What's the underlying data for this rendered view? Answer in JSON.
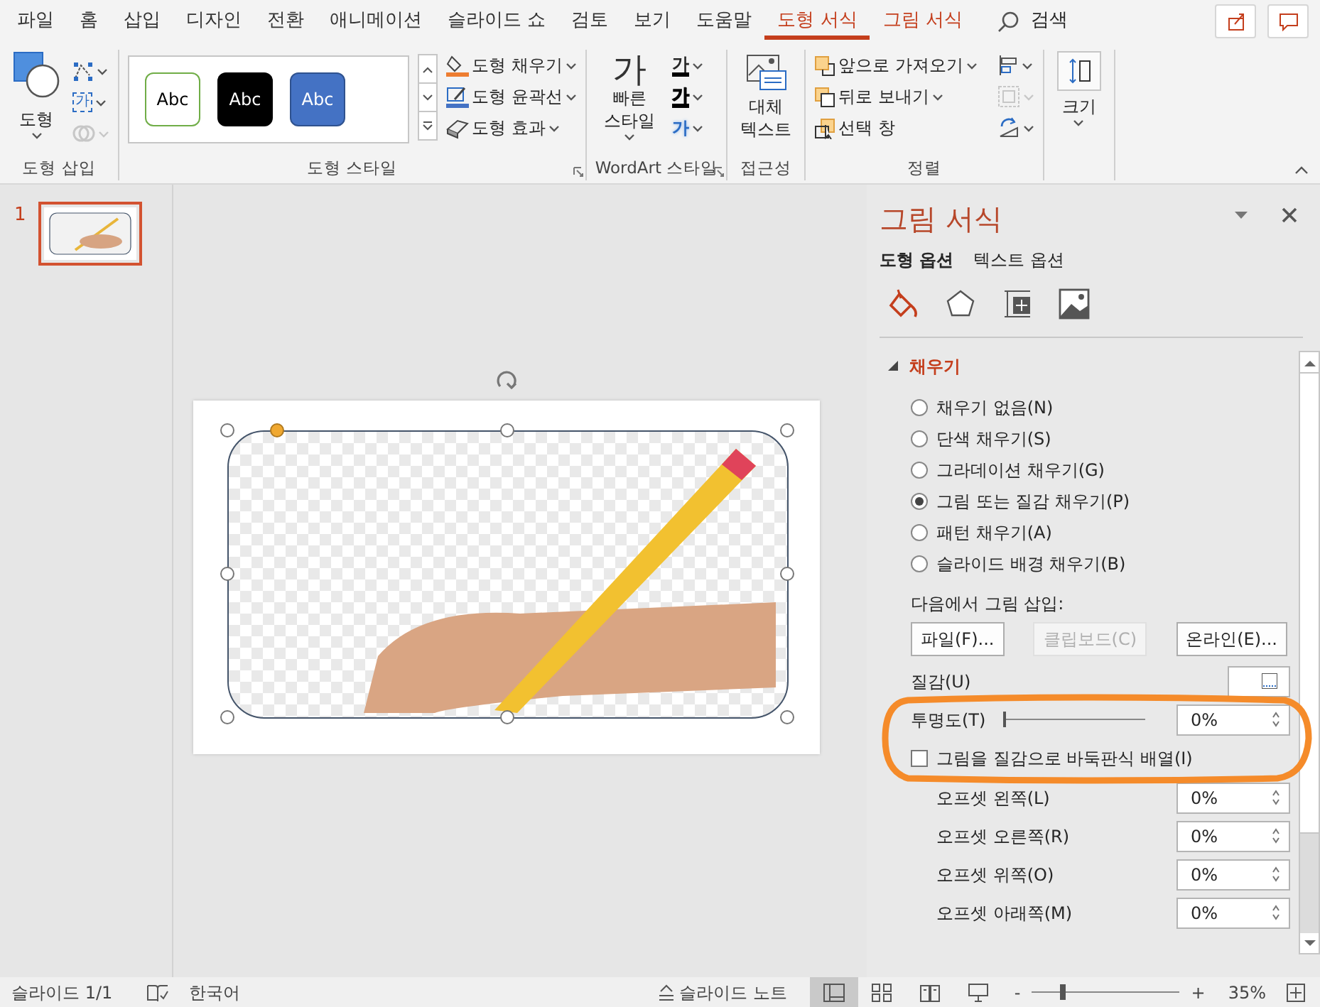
{
  "menu_tabs": [
    {
      "label": "파일",
      "selected": false,
      "contextual": false
    },
    {
      "label": "홈",
      "selected": false,
      "contextual": false
    },
    {
      "label": "삽입",
      "selected": false,
      "contextual": false
    },
    {
      "label": "디자인",
      "selected": false,
      "contextual": false
    },
    {
      "label": "전환",
      "selected": false,
      "contextual": false
    },
    {
      "label": "애니메이션",
      "selected": false,
      "contextual": false
    },
    {
      "label": "슬라이드 쇼",
      "selected": false,
      "contextual": false
    },
    {
      "label": "검토",
      "selected": false,
      "contextual": false
    },
    {
      "label": "보기",
      "selected": false,
      "contextual": false
    },
    {
      "label": "도움말",
      "selected": false,
      "contextual": false
    },
    {
      "label": "도형 서식",
      "selected": true,
      "contextual": true
    },
    {
      "label": "그림 서식",
      "selected": false,
      "contextual": true
    }
  ],
  "search": {
    "label": "검색"
  },
  "ribbon_groups": [
    {
      "kind": "insert-shapes",
      "label": "도형 삽입",
      "button": "도형",
      "tools": [
        {
          "kind": "edit-shape",
          "disabled": false
        },
        {
          "kind": "textbox",
          "glyph": "가",
          "disabled": false
        },
        {
          "kind": "merge",
          "disabled": true
        }
      ]
    },
    {
      "kind": "shape-styles",
      "label": "도형 스타일",
      "launcher": true,
      "swatches": [
        {
          "text": "Abc",
          "kind": "outline"
        },
        {
          "text": "Abc",
          "kind": "dark"
        },
        {
          "text": "Abc",
          "kind": "accent"
        }
      ],
      "commands": [
        {
          "kind": "fill",
          "label": "도형 채우기"
        },
        {
          "kind": "outline",
          "label": "도형 윤곽선"
        },
        {
          "kind": "effects",
          "label": "도형 효과"
        }
      ]
    },
    {
      "kind": "wordart",
      "label": "WordArt 스타일",
      "launcher": true,
      "glyph": "가",
      "button": "빠른 스타일",
      "tools": [
        {
          "kind": "fill",
          "glyph": "가"
        },
        {
          "kind": "outline",
          "glyph": "가"
        },
        {
          "kind": "effects",
          "glyph": "가"
        }
      ]
    },
    {
      "kind": "accessibility",
      "label": "접근성",
      "button": "대체 텍스트"
    },
    {
      "kind": "arrange",
      "label": "정렬",
      "commands": [
        {
          "kind": "forward",
          "label": "앞으로 가져오기",
          "dropdown": true
        },
        {
          "kind": "backward",
          "label": "뒤로 보내기",
          "dropdown": true
        },
        {
          "kind": "selection",
          "label": "선택 창",
          "dropdown": false
        }
      ],
      "tools": [
        {
          "kind": "align",
          "disabled": false
        },
        {
          "kind": "group",
          "disabled": true
        },
        {
          "kind": "rotate",
          "disabled": false
        }
      ]
    },
    {
      "kind": "size",
      "button": "크기"
    }
  ],
  "slides": [
    {
      "number": "1",
      "selected": true
    }
  ],
  "format_pane": {
    "title": "그림 서식",
    "option_tabs": [
      {
        "label": "도형 옵션",
        "selected": true
      },
      {
        "label": "텍스트 옵션",
        "selected": false
      }
    ],
    "icon_tabs": [
      {
        "kind": "fill",
        "selected": true
      },
      {
        "kind": "effects",
        "selected": false
      },
      {
        "kind": "size",
        "selected": false
      },
      {
        "kind": "picture",
        "selected": false
      }
    ],
    "section": {
      "title": "채우기",
      "expanded": true
    },
    "fill_options": [
      {
        "label": "채우기 없음(N)",
        "selected": false
      },
      {
        "label": "단색 채우기(S)",
        "selected": false
      },
      {
        "label": "그라데이션 채우기(G)",
        "selected": false
      },
      {
        "label": "그림 또는 질감 채우기(P)",
        "selected": true
      },
      {
        "label": "패턴 채우기(A)",
        "selected": false
      },
      {
        "label": "슬라이드 배경 채우기(B)",
        "selected": false
      }
    ],
    "insert_label": "다음에서 그림 삽입:",
    "insert_buttons": [
      {
        "label": "파일(F)...",
        "disabled": false
      },
      {
        "label": "클립보드(C)",
        "disabled": true
      },
      {
        "label": "온라인(E)...",
        "disabled": false
      }
    ],
    "texture_label": "질감(U)",
    "transparency": {
      "label": "투명도(T)",
      "level": 0,
      "value": "0%"
    },
    "tile_checkbox": {
      "label": "그림을 질감으로 바둑판식 배열(I)",
      "checked": false
    },
    "offsets": [
      {
        "label": "오프셋 왼쪽(L)",
        "value": "0%"
      },
      {
        "label": "오프셋 오른쪽(R)",
        "value": "0%"
      },
      {
        "label": "오프셋 위쪽(O)",
        "value": "0%"
      },
      {
        "label": "오프셋 아래쪽(M)",
        "value": "0%"
      }
    ],
    "annotation": {
      "kind": "freehand-loop"
    }
  },
  "status_bar": {
    "slide": "슬라이드 1/1",
    "language": "한국어",
    "notes": "슬라이드 노트",
    "views": [
      {
        "kind": "normal",
        "selected": true
      },
      {
        "kind": "sorter",
        "selected": false
      },
      {
        "kind": "reading",
        "selected": false
      },
      {
        "kind": "show",
        "selected": false
      }
    ],
    "zoom": {
      "minus": "-",
      "plus": "+",
      "level": 0.2,
      "value": "35%"
    }
  }
}
